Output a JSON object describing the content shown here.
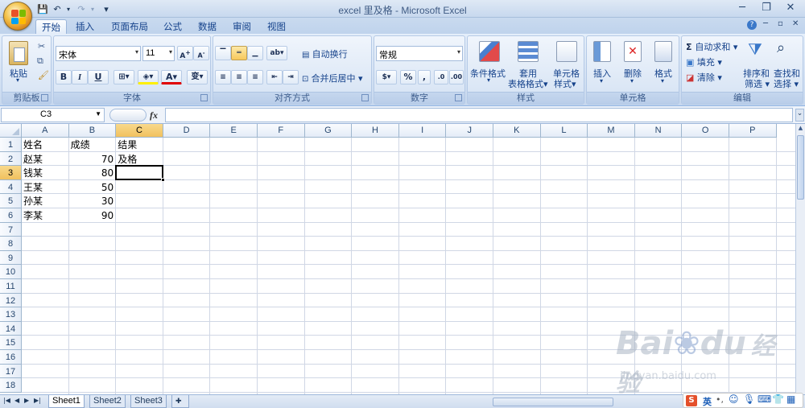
{
  "window": {
    "title": "excel 里及格 - Microsoft Excel"
  },
  "qat": {
    "save": "💾",
    "undo": "↶",
    "redo": "↷",
    "more": "▾"
  },
  "window_controls": {
    "minimize": "─",
    "restore": "❐",
    "close": "✕"
  },
  "tabs": [
    "开始",
    "插入",
    "页面布局",
    "公式",
    "数据",
    "审阅",
    "视图"
  ],
  "ribbon": {
    "clipboard": {
      "label": "剪贴板",
      "paste": "粘贴"
    },
    "font": {
      "label": "字体",
      "name": "宋体",
      "size": "11",
      "bold": "B",
      "italic": "I",
      "underline": "U",
      "font_color_letter": "A",
      "wen": "变"
    },
    "alignment": {
      "label": "对齐方式",
      "wrap": "自动换行",
      "merge": "合并后居中 ▾"
    },
    "number": {
      "label": "数字",
      "format": "常规",
      "percent": "%",
      "comma": ","
    },
    "styles": {
      "label": "样式",
      "conditional": "条件格式",
      "table_line1": "套用",
      "table_line2": "表格格式",
      "cell_line1": "单元格",
      "cell_line2": "样式"
    },
    "cells": {
      "label": "单元格",
      "insert": "插入",
      "delete": "删除",
      "format": "格式"
    },
    "editing": {
      "label": "编辑",
      "autosum": "自动求和",
      "fill": "填充",
      "clear": "清除",
      "sort_line1": "排序和",
      "sort_line2": "筛选",
      "find_line1": "查找和",
      "find_line2": "选择"
    }
  },
  "formula_bar": {
    "name_box": "C3",
    "fx": "fx",
    "value": ""
  },
  "columns": [
    "A",
    "B",
    "C",
    "D",
    "E",
    "F",
    "G",
    "H",
    "I",
    "J",
    "K",
    "L",
    "M",
    "N",
    "O",
    "P"
  ],
  "rows": [
    "1",
    "2",
    "3",
    "4",
    "5",
    "6",
    "7",
    "8",
    "9",
    "10",
    "11",
    "12",
    "13",
    "14",
    "15",
    "16",
    "17",
    "18"
  ],
  "cells": {
    "A1": "姓名",
    "B1": "成绩",
    "C1": "结果",
    "A2": "赵某",
    "B2": "70",
    "C2": "及格",
    "A3": "钱某",
    "B3": "80",
    "A4": "王某",
    "B4": "50",
    "A5": "孙某",
    "B5": "30",
    "A6": "李某",
    "B6": "90"
  },
  "sheets": [
    "Sheet1",
    "Sheet2",
    "Sheet3"
  ],
  "ime": {
    "lang": "英"
  },
  "watermark": {
    "brand": "Bai",
    "brand2": "du",
    "cn": "经验",
    "url": "jingyan.baidu.com"
  },
  "colors": {
    "accent": "#15428b",
    "selection": "#f1c15e",
    "ribbon": "#d3e1f3"
  }
}
